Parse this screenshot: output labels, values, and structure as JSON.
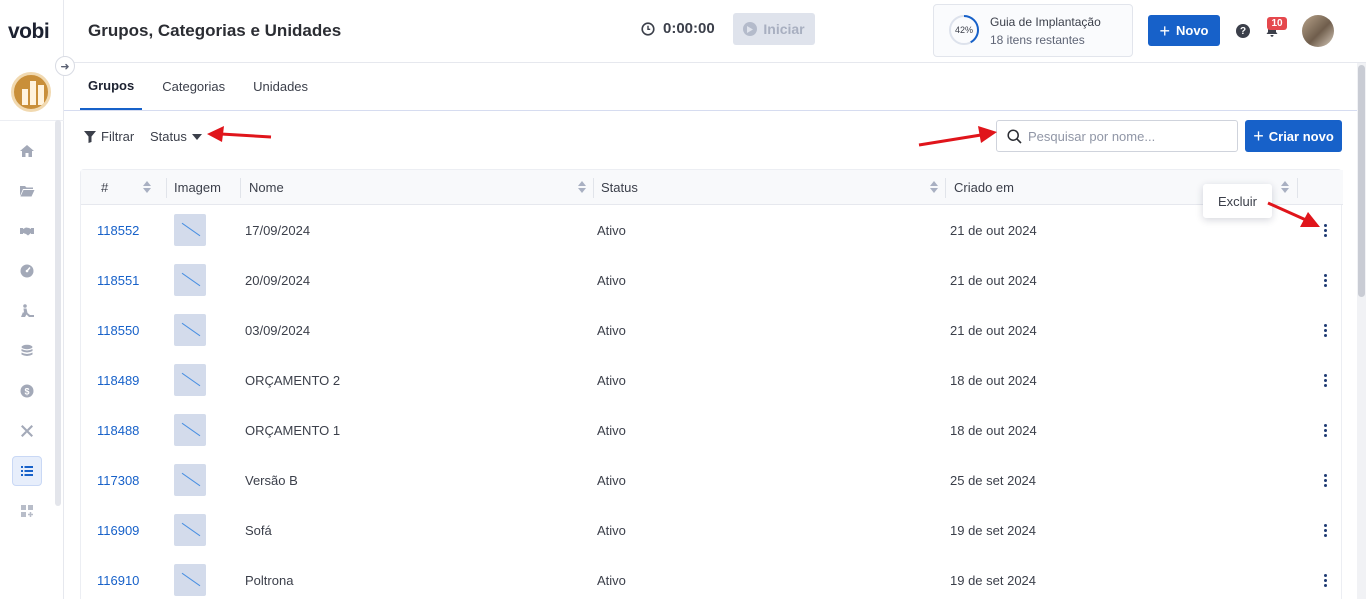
{
  "app": {
    "logo": "vobi",
    "title": "Grupos, Categorias e Unidades"
  },
  "header": {
    "timer": "0:00:00",
    "start_label": "Iniciar",
    "guide": {
      "percent_label": "42%",
      "percent": 42,
      "title": "Guia de Implantação",
      "subtitle": "18 itens restantes"
    },
    "new_label": "Novo",
    "notifications_count": "10"
  },
  "sidebar": {
    "items": [
      {
        "name": "home",
        "icon": "home-icon"
      },
      {
        "name": "projects",
        "icon": "folder-open-icon"
      },
      {
        "name": "deals",
        "icon": "handshake-icon"
      },
      {
        "name": "dashboard",
        "icon": "gauge-icon"
      },
      {
        "name": "works",
        "icon": "worker-icon"
      },
      {
        "name": "database",
        "icon": "coins-icon"
      },
      {
        "name": "finance",
        "icon": "dollar-icon"
      },
      {
        "name": "tools",
        "icon": "tools-icon"
      },
      {
        "name": "lists",
        "icon": "list-icon",
        "active": true
      },
      {
        "name": "apps",
        "icon": "apps-plus-icon"
      }
    ]
  },
  "tabs": [
    {
      "label": "Grupos",
      "active": true
    },
    {
      "label": "Categorias",
      "active": false
    },
    {
      "label": "Unidades",
      "active": false
    }
  ],
  "toolbar": {
    "filter_label": "Filtrar",
    "status_label": "Status",
    "search_placeholder": "Pesquisar por nome...",
    "create_label": "Criar novo"
  },
  "table": {
    "headers": {
      "id": "#",
      "image": "Imagem",
      "name": "Nome",
      "status": "Status",
      "created": "Criado em"
    },
    "rows": [
      {
        "id": "118552",
        "name": "17/09/2024",
        "status": "Ativo",
        "created": "21 de out 2024"
      },
      {
        "id": "118551",
        "name": "20/09/2024",
        "status": "Ativo",
        "created": "21 de out 2024"
      },
      {
        "id": "118550",
        "name": "03/09/2024",
        "status": "Ativo",
        "created": "21 de out 2024"
      },
      {
        "id": "118489",
        "name": "ORÇAMENTO 2",
        "status": "Ativo",
        "created": "18 de out 2024"
      },
      {
        "id": "118488",
        "name": "ORÇAMENTO 1",
        "status": "Ativo",
        "created": "18 de out 2024"
      },
      {
        "id": "117308",
        "name": "Versão B",
        "status": "Ativo",
        "created": "25 de set 2024"
      },
      {
        "id": "116909",
        "name": "Sofá",
        "status": "Ativo",
        "created": "19 de set 2024"
      },
      {
        "id": "116910",
        "name": "Poltrona",
        "status": "Ativo",
        "created": "19 de set 2024"
      }
    ]
  },
  "row_menu": {
    "delete_label": "Excluir"
  },
  "colors": {
    "primary": "#1761c9",
    "annotation_arrow": "#e0151b"
  }
}
